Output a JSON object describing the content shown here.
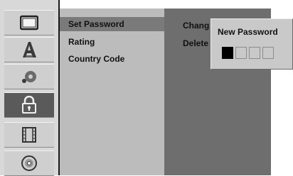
{
  "icons": [
    {
      "name": "tv-icon"
    },
    {
      "name": "language-icon"
    },
    {
      "name": "audio-icon"
    },
    {
      "name": "lock-icon",
      "selected": true
    },
    {
      "name": "film-icon"
    },
    {
      "name": "disc-icon"
    }
  ],
  "menu": {
    "items": [
      {
        "label": "Set Password",
        "active": true
      },
      {
        "label": "Rating"
      },
      {
        "label": "Country Code"
      }
    ]
  },
  "options": {
    "items": [
      {
        "label": "Chang"
      },
      {
        "label": "Delete"
      }
    ]
  },
  "popup": {
    "title": "New Password",
    "digits_total": 4,
    "digits_entered": 1
  },
  "colors": {
    "menu_bg": "#bcbcbc",
    "options_bg": "#6e6e6e",
    "selected_icon_bg": "#5a5a5a"
  }
}
